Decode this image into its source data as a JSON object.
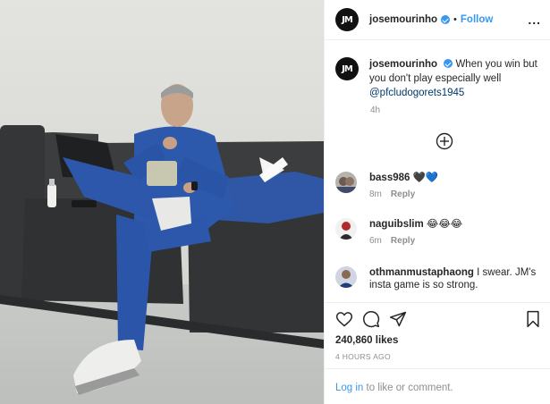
{
  "post": {
    "username": "josemourinho",
    "avatar_initials": "JM",
    "follow_label": "Follow",
    "dot_separator": "•",
    "more_label": "...",
    "caption_text": "When you win but you don't play especially well",
    "caption_mention": "@pfcludogorets1945",
    "caption_age": "4h",
    "likes": "240,860 likes",
    "posted_ago": "4 HOURS AGO"
  },
  "comments": [
    {
      "username": "bass986",
      "text": "🖤💙",
      "age": "8m",
      "reply_label": "Reply"
    },
    {
      "username": "naguibslim",
      "text": "😂😂😂",
      "age": "6m",
      "reply_label": "Reply"
    },
    {
      "username": "othmanmustaphaong",
      "text": "I swear. JM's insta game is so strong.",
      "age": "",
      "reply_label": ""
    }
  ],
  "footer": {
    "login_label": "Log in",
    "login_suffix": " to like or comment."
  },
  "icons": [
    "more-options-icon",
    "verified-badge-icon",
    "load-more-comments-icon",
    "heart-icon",
    "comment-icon",
    "share-icon",
    "bookmark-icon"
  ],
  "colors": {
    "accent": "#3897f0",
    "mention": "#00376b",
    "muted": "#8e8e8e",
    "text": "#262626"
  }
}
